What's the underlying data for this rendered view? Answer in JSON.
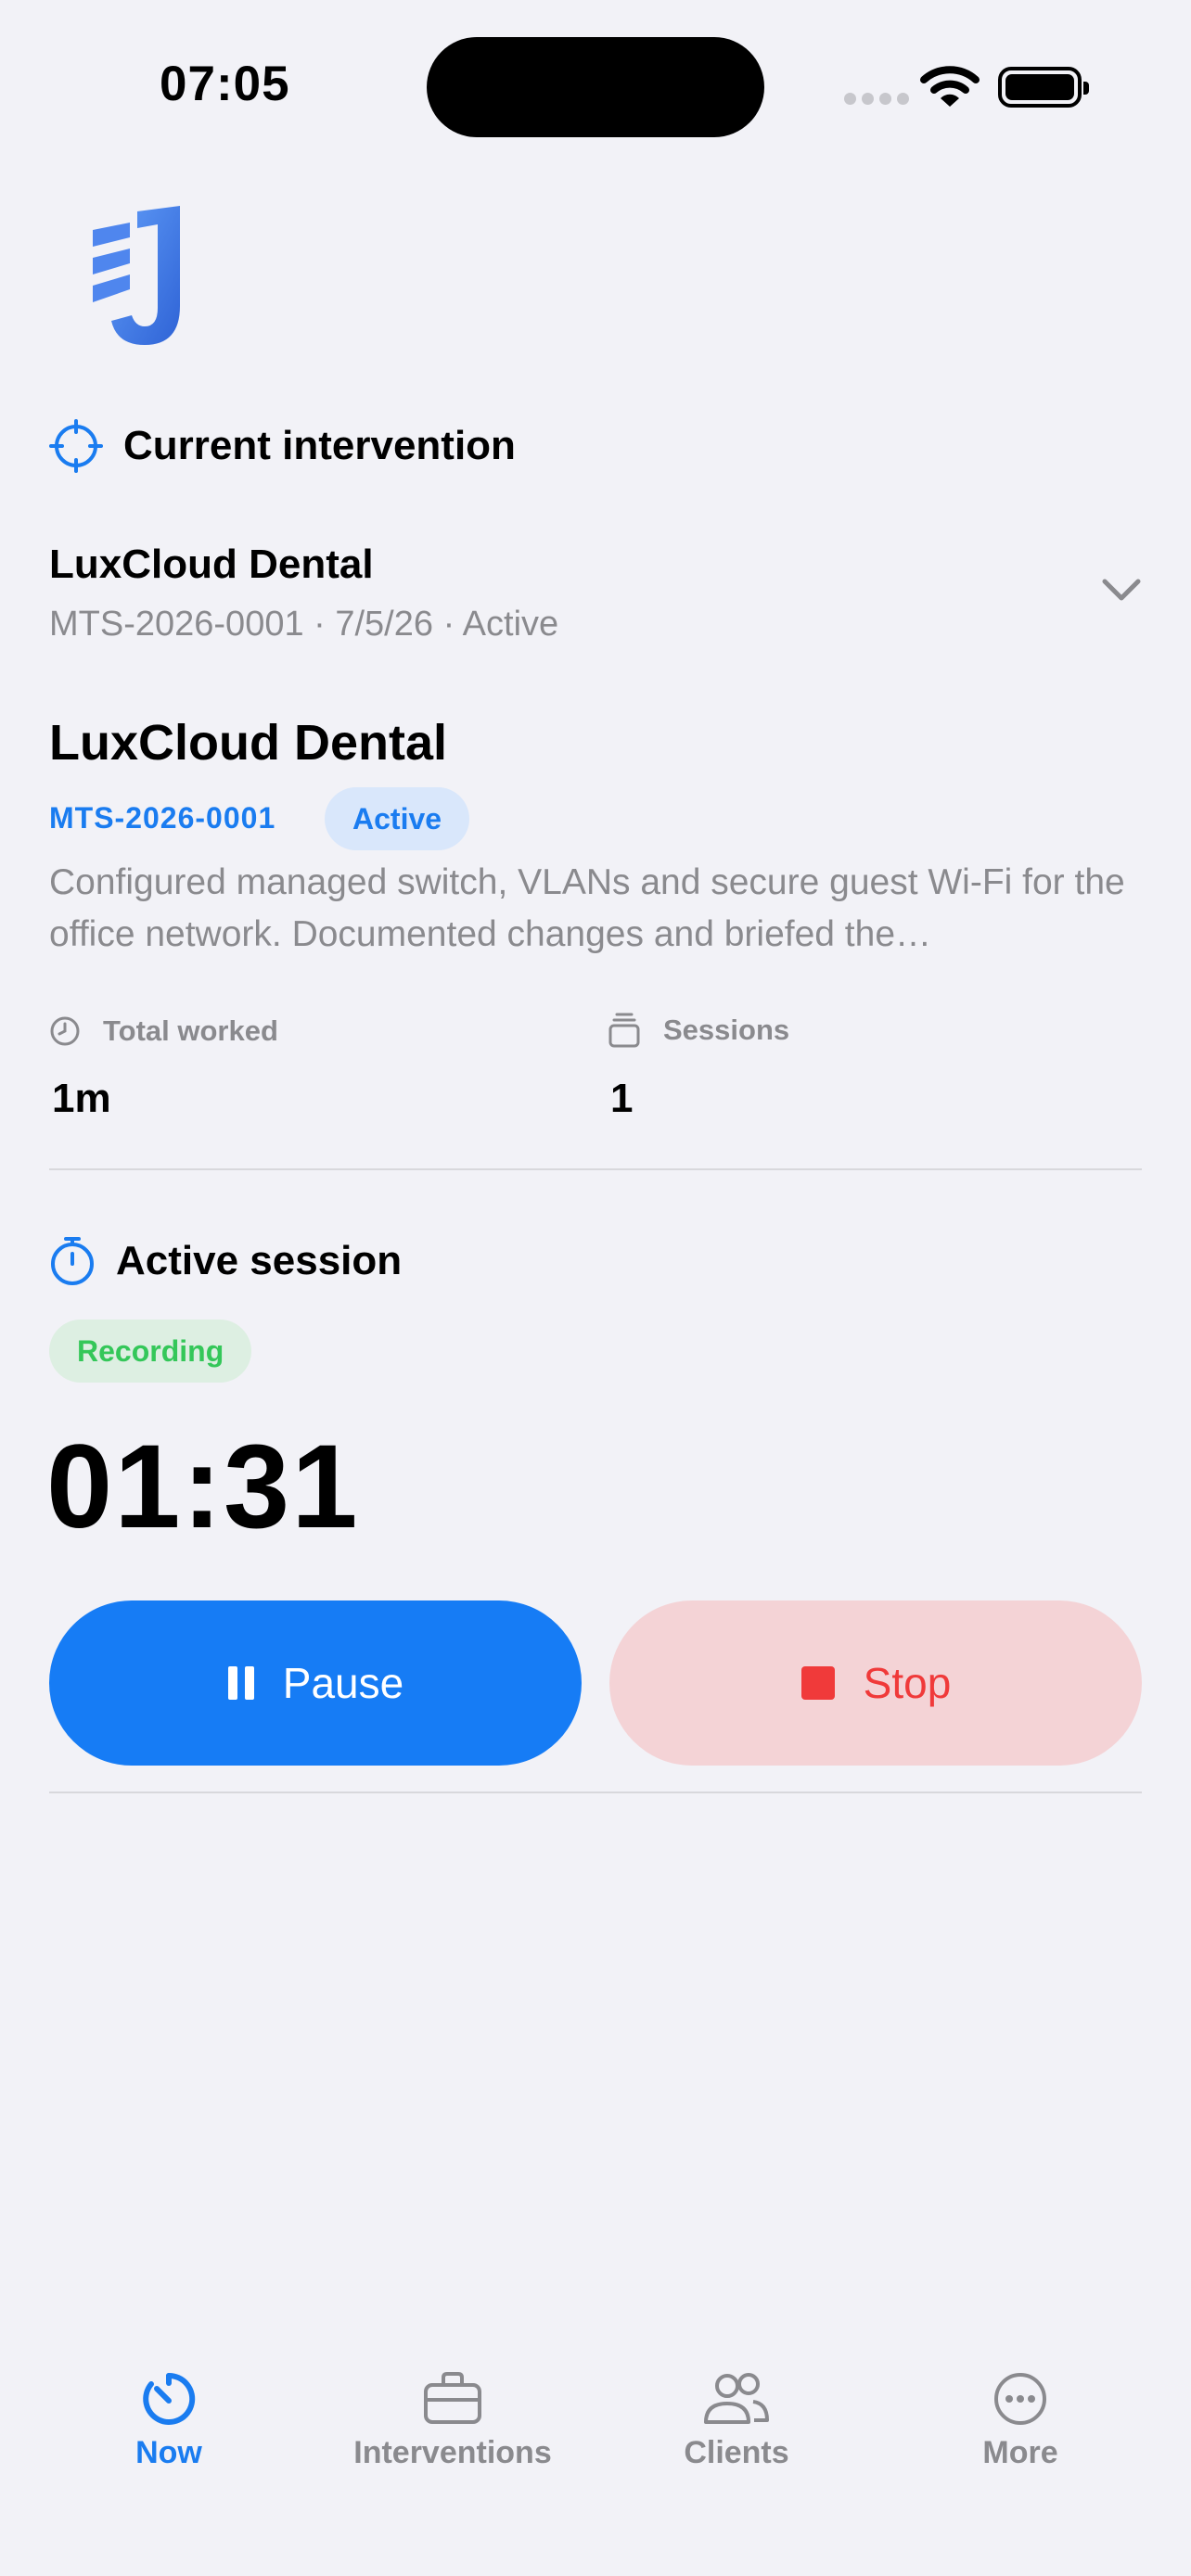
{
  "status_bar": {
    "time": "07:05"
  },
  "current_section": {
    "title": "Current intervention"
  },
  "selector": {
    "name": "LuxCloud Dental",
    "meta": "MTS-2026-0001 · 7/5/26 · Active"
  },
  "detail": {
    "name": "LuxCloud Dental",
    "code": "MTS-2026-0001",
    "status": "Active",
    "description": "Configured managed switch, VLANs and secure guest Wi-Fi for the office network. Documented changes and briefed the…"
  },
  "stats": {
    "total_worked_label": "Total worked",
    "total_worked_value": "1m",
    "sessions_label": "Sessions",
    "sessions_value": "1"
  },
  "active_session": {
    "title": "Active session",
    "badge": "Recording",
    "timer": "01:31",
    "pause_label": "Pause",
    "stop_label": "Stop"
  },
  "tabs": [
    {
      "label": "Now",
      "icon": "timer-icon"
    },
    {
      "label": "Interventions",
      "icon": "briefcase-icon"
    },
    {
      "label": "Clients",
      "icon": "people-icon"
    },
    {
      "label": "More",
      "icon": "ellipsis-circle-icon"
    }
  ],
  "colors": {
    "accent": "#1a7cf0",
    "recording": "#34c759",
    "stop": "#f03a3a",
    "background": "#f2f2f7"
  }
}
